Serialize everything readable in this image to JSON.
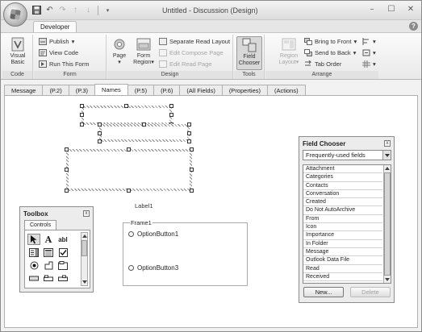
{
  "window": {
    "title": "Untitled - Discussion",
    "mode": "(Design)"
  },
  "ribbon_tab": "Developer",
  "groups": {
    "code": {
      "label": "Code",
      "visual_basic": "Visual Basic"
    },
    "form": {
      "label": "Form",
      "publish": "Publish",
      "view_code": "View Code",
      "run_this_form": "Run This Form"
    },
    "design": {
      "label": "Design",
      "page": "Page",
      "form_region": "Form Region",
      "separate_read_layout": "Separate Read Layout",
      "edit_compose_page": "Edit Compose Page",
      "edit_read_page": "Edit Read Page"
    },
    "tools": {
      "label": "Tools",
      "field_chooser": "Field Chooser"
    },
    "arrange": {
      "label": "Arrange",
      "region_layout": "Region Layout",
      "bring_to_front": "Bring to Front",
      "send_to_back": "Send to Back",
      "tab_order": "Tab Order"
    }
  },
  "page_tabs": [
    "Message",
    "(P.2)",
    "(P.3)",
    "Names",
    "(P.5)",
    "(P.6)",
    "(All Fields)",
    "(Properties)",
    "(Actions)"
  ],
  "design": {
    "label1": "Label1",
    "frame_title": "Frame1",
    "option1": "OptionButton1",
    "option3": "OptionButton3"
  },
  "toolbox": {
    "title": "Toolbox",
    "tab": "Controls"
  },
  "field_chooser": {
    "title": "Field Chooser",
    "dropdown": "Frequently-used fields",
    "fields": [
      "Attachment",
      "Categories",
      "Contacts",
      "Conversation",
      "Created",
      "Do Not AutoArchive",
      "From",
      "Icon",
      "Importance",
      "In Folder",
      "Message",
      "Outlook Data File",
      "Read",
      "Received"
    ],
    "new_button": "New...",
    "delete_button": "Delete"
  }
}
